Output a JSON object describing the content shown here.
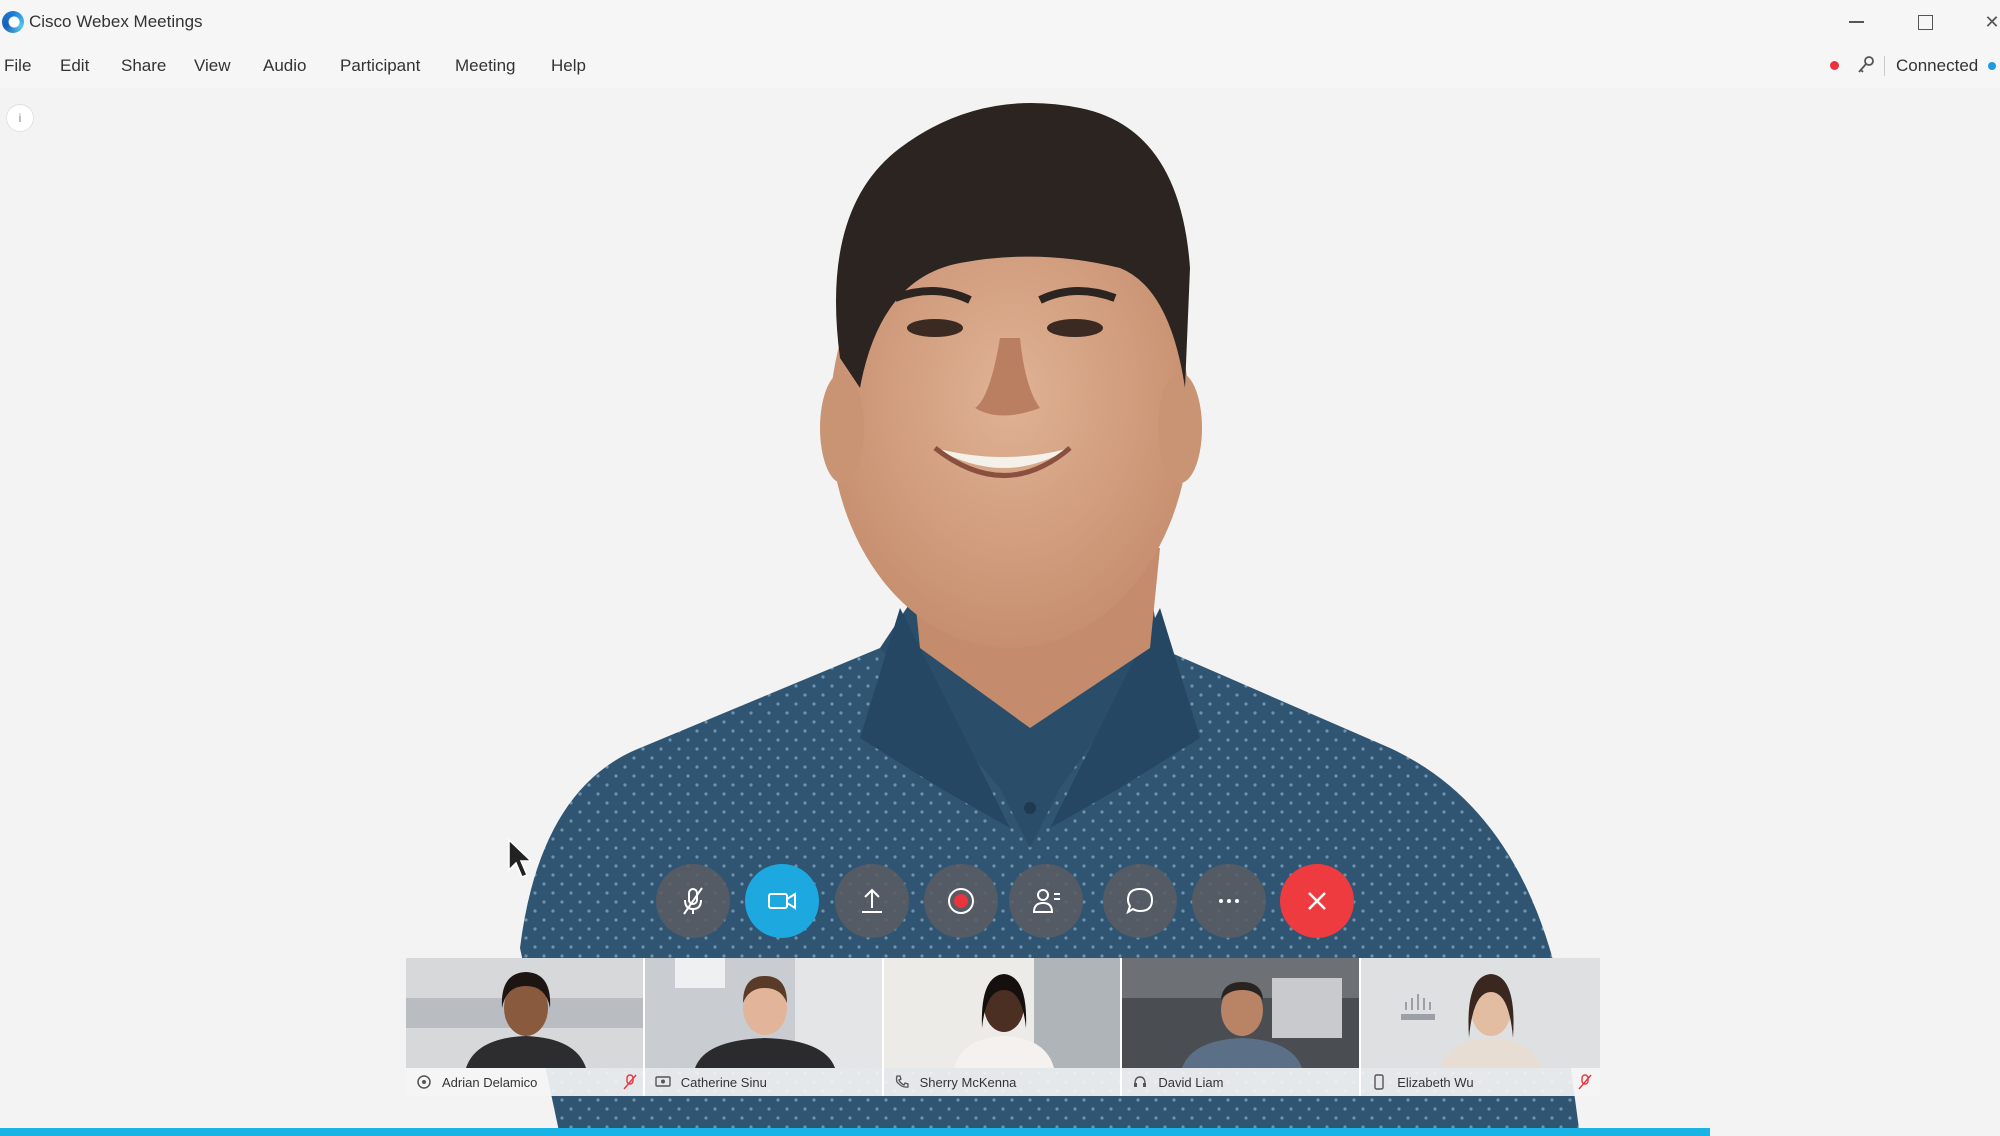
{
  "window": {
    "title": "Cisco Webex Meetings"
  },
  "menu": [
    "File",
    "Edit",
    "Share",
    "View",
    "Audio",
    "Participant",
    "Meeting",
    "Help"
  ],
  "status": {
    "connection": "Connected",
    "recording_color": "#e8353d",
    "accent": "#1ea8e0",
    "leave_color": "#ee3b3f"
  },
  "controls": [
    {
      "name": "mute-button",
      "icon": "microphone-muted-icon"
    },
    {
      "name": "video-button",
      "icon": "video-camera-icon"
    },
    {
      "name": "share-button",
      "icon": "upload-icon"
    },
    {
      "name": "record-button",
      "icon": "record-icon"
    },
    {
      "name": "participants-button",
      "icon": "participants-icon"
    },
    {
      "name": "chat-button",
      "icon": "chat-bubble-icon"
    },
    {
      "name": "more-button",
      "icon": "more-icon"
    },
    {
      "name": "leave-button",
      "icon": "close-icon"
    }
  ],
  "participants": [
    {
      "name": "Adrian Delamico",
      "device": "webex-app-icon",
      "muted": true
    },
    {
      "name": "Catherine Sinu",
      "device": "video-system-icon",
      "muted": false
    },
    {
      "name": "Sherry McKenna",
      "device": "phone-icon",
      "muted": false
    },
    {
      "name": "David Liam",
      "device": "headset-icon",
      "muted": false
    },
    {
      "name": "Elizabeth Wu",
      "device": "mobile-icon",
      "muted": true
    }
  ]
}
